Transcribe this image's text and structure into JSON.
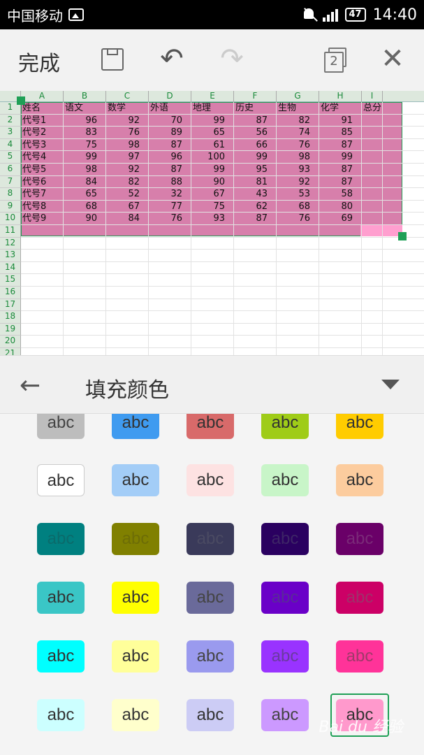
{
  "status_bar": {
    "carrier": "中国移动",
    "battery": "47",
    "time": "14:40"
  },
  "toolbar": {
    "done_label": "完成",
    "sheet_count": "2"
  },
  "sheet": {
    "columns": [
      "A",
      "B",
      "C",
      "D",
      "E",
      "F",
      "G",
      "H",
      "I"
    ],
    "row_numbers": [
      "1",
      "2",
      "3",
      "4",
      "5",
      "6",
      "7",
      "8",
      "9",
      "10",
      "11",
      "12",
      "13",
      "14",
      "15",
      "16",
      "17",
      "18",
      "19",
      "20",
      "21"
    ],
    "rows": [
      [
        "姓名",
        "语文",
        "数学",
        "外语",
        "地理",
        "历史",
        "生物",
        "化学",
        "总分"
      ],
      [
        "代号1",
        "96",
        "92",
        "70",
        "99",
        "87",
        "82",
        "91",
        ""
      ],
      [
        "代号2",
        "83",
        "76",
        "89",
        "65",
        "56",
        "74",
        "85",
        ""
      ],
      [
        "代号3",
        "75",
        "98",
        "87",
        "61",
        "66",
        "76",
        "87",
        ""
      ],
      [
        "代号4",
        "99",
        "97",
        "96",
        "100",
        "99",
        "98",
        "99",
        ""
      ],
      [
        "代号5",
        "98",
        "92",
        "87",
        "99",
        "95",
        "93",
        "87",
        ""
      ],
      [
        "代号6",
        "84",
        "82",
        "88",
        "90",
        "81",
        "92",
        "87",
        ""
      ],
      [
        "代号7",
        "65",
        "52",
        "32",
        "67",
        "43",
        "53",
        "58",
        ""
      ],
      [
        "代号8",
        "68",
        "67",
        "77",
        "75",
        "62",
        "68",
        "80",
        ""
      ],
      [
        "代号9",
        "90",
        "84",
        "76",
        "93",
        "87",
        "76",
        "69",
        ""
      ]
    ],
    "selection_fill": "#d77fab"
  },
  "panel": {
    "title": "填充颜色"
  },
  "swatch_label": "abc",
  "swatches": [
    {
      "bg": "#bdbdbd",
      "fg": "#444"
    },
    {
      "bg": "#3f9bf0",
      "fg": "#333"
    },
    {
      "bg": "#d86a6a",
      "fg": "#333"
    },
    {
      "bg": "#9fcc18",
      "fg": "#333"
    },
    {
      "bg": "#ffcc00",
      "fg": "#333"
    },
    {
      "bg": "#ffffff",
      "fg": "#333"
    },
    {
      "bg": "#a3cdf7",
      "fg": "#333"
    },
    {
      "bg": "#fde2e2",
      "fg": "#333"
    },
    {
      "bg": "#c8f5c8",
      "fg": "#333"
    },
    {
      "bg": "#fccc9e",
      "fg": "#333"
    },
    {
      "bg": "#008080",
      "fg": "#0a6b6b"
    },
    {
      "bg": "#808000",
      "fg": "#6d6d06"
    },
    {
      "bg": "#3a3a5a",
      "fg": "#4a4a62"
    },
    {
      "bg": "#2a0060",
      "fg": "#3d2566"
    },
    {
      "bg": "#6a0068",
      "fg": "#7a2a78"
    },
    {
      "bg": "#3ac6c6",
      "fg": "#333"
    },
    {
      "bg": "#ffff00",
      "fg": "#333"
    },
    {
      "bg": "#6a6a9a",
      "fg": "#444"
    },
    {
      "bg": "#6a00c8",
      "fg": "#5a2a9a"
    },
    {
      "bg": "#cc0066",
      "fg": "#a0306a"
    },
    {
      "bg": "#00ffff",
      "fg": "#333"
    },
    {
      "bg": "#ffff9a",
      "fg": "#333"
    },
    {
      "bg": "#9a9aee",
      "fg": "#444"
    },
    {
      "bg": "#9933ff",
      "fg": "#6a3aa0"
    },
    {
      "bg": "#ff3399",
      "fg": "#a03a6a"
    },
    {
      "bg": "#ccffff",
      "fg": "#333"
    },
    {
      "bg": "#ffffcc",
      "fg": "#333"
    },
    {
      "bg": "#ccccf5",
      "fg": "#333"
    },
    {
      "bg": "#cc99ff",
      "fg": "#444"
    },
    {
      "bg": "#ff99cc",
      "fg": "#333"
    }
  ],
  "selected_swatch_index": 29,
  "watermark": "Bai du 经验"
}
